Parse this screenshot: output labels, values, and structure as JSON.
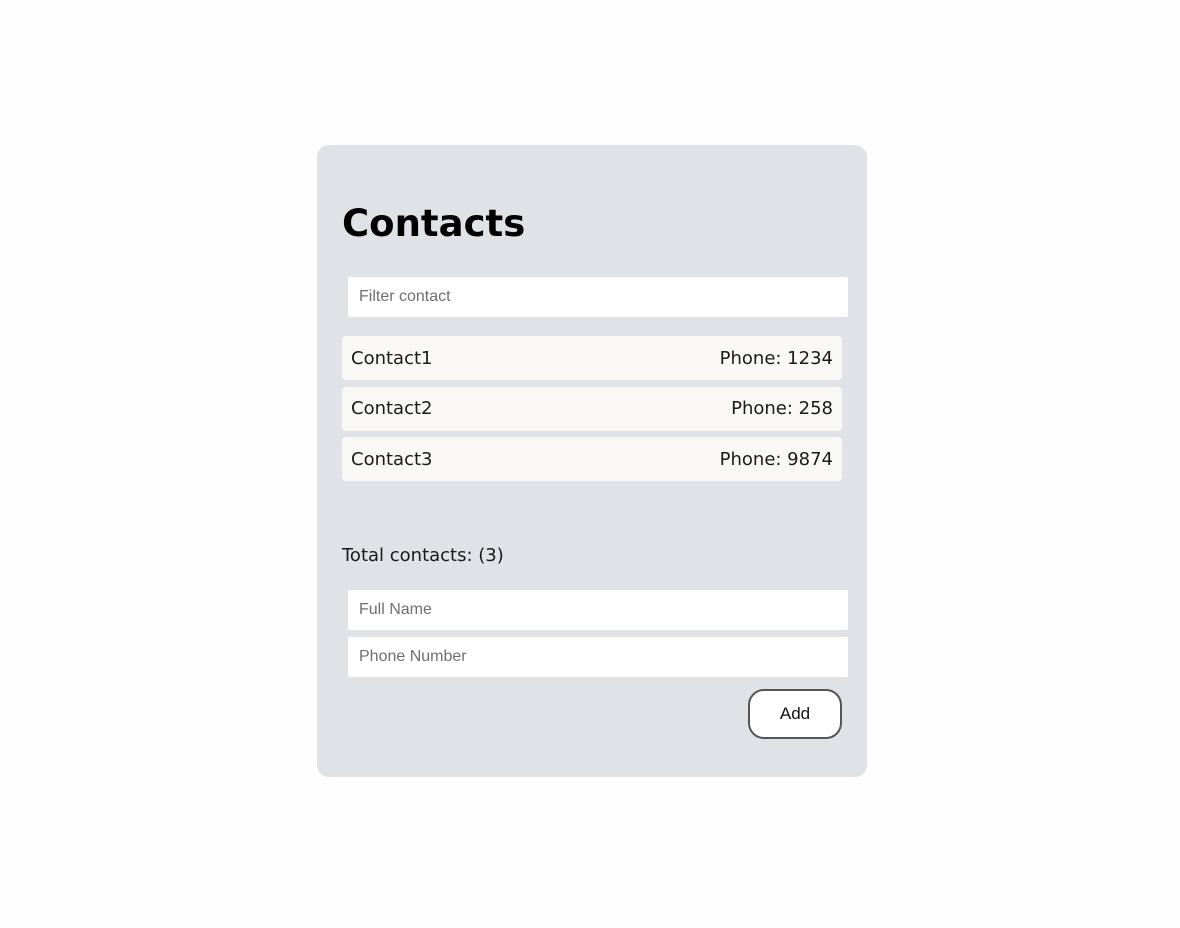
{
  "header": {
    "title": "Contacts"
  },
  "filter": {
    "placeholder": "Filter contact",
    "value": ""
  },
  "contacts": [
    {
      "name": "Contact1",
      "phone": "Phone: 1234"
    },
    {
      "name": "Contact2",
      "phone": "Phone: 258"
    },
    {
      "name": "Contact3",
      "phone": "Phone: 9874"
    }
  ],
  "summary": {
    "total_label": "Total contacts: (3)"
  },
  "form": {
    "name_placeholder": "Full Name",
    "phone_placeholder": "Phone Number",
    "add_label": "Add"
  },
  "colors": {
    "page_background": "#fefefe",
    "card_background": "#dfe2e6",
    "row_background": "#f9f8f5"
  }
}
